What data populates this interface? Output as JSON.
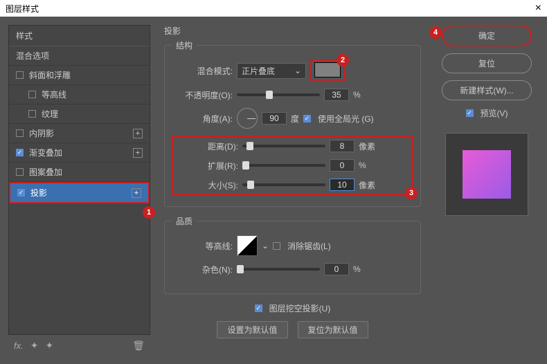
{
  "window": {
    "title": "图层样式"
  },
  "sidebar": {
    "header": "样式",
    "blend_options": "混合选项",
    "items": [
      {
        "label": "斜面和浮雕",
        "checked": false,
        "plus": false
      },
      {
        "label": "等高线",
        "checked": false,
        "plus": false,
        "sub": true
      },
      {
        "label": "纹理",
        "checked": false,
        "plus": false,
        "sub": true
      },
      {
        "label": "内阴影",
        "checked": false,
        "plus": true
      },
      {
        "label": "渐变叠加",
        "checked": true,
        "plus": true
      },
      {
        "label": "图案叠加",
        "checked": false,
        "plus": false
      },
      {
        "label": "投影",
        "checked": true,
        "plus": true,
        "selected": true
      }
    ]
  },
  "panel": {
    "title": "投影",
    "structure": {
      "legend": "结构",
      "blend_mode_label": "混合模式:",
      "blend_mode_value": "正片叠底",
      "opacity_label": "不透明度(O):",
      "opacity_value": "35",
      "opacity_unit": "%",
      "angle_label": "角度(A):",
      "angle_value": "90",
      "angle_unit": "度",
      "global_light": "使用全局光 (G)",
      "distance_label": "距离(D):",
      "distance_value": "8",
      "distance_unit": "像素",
      "spread_label": "扩展(R):",
      "spread_value": "0",
      "spread_unit": "%",
      "size_label": "大小(S):",
      "size_value": "10",
      "size_unit": "像素"
    },
    "quality": {
      "legend": "品质",
      "contour_label": "等高线:",
      "antialias": "消除锯齿(L)",
      "noise_label": "杂色(N):",
      "noise_value": "0",
      "noise_unit": "%"
    },
    "knockout": "图层挖空投影(U)",
    "set_default": "设置为默认值",
    "reset_default": "复位为默认值"
  },
  "buttons": {
    "ok": "确定",
    "cancel": "复位",
    "new_style": "新建样式(W)...",
    "preview": "预览(V)"
  },
  "badges": {
    "b1": "1",
    "b2": "2",
    "b3": "3",
    "b4": "4"
  }
}
